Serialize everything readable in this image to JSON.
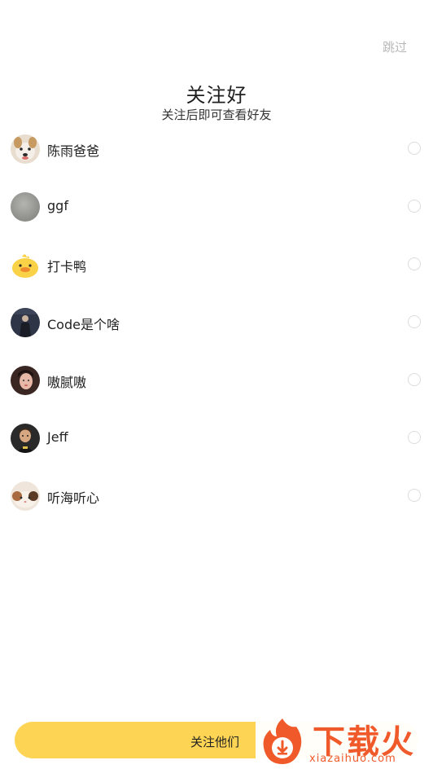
{
  "header": {
    "skip_label": "跳过",
    "title": "关注好",
    "subtitle": "关注后即可查看好友"
  },
  "friends": [
    {
      "name": "陈雨爸爸",
      "avatar": "dog-photo",
      "selected": false
    },
    {
      "name": "ggf",
      "avatar": "gray-blur-photo",
      "selected": false
    },
    {
      "name": "打卡鸭",
      "avatar": "duck-illustration",
      "selected": false
    },
    {
      "name": "Code是个啥",
      "avatar": "person-dark-photo",
      "selected": false
    },
    {
      "name": "嗷腻嗷",
      "avatar": "girl-photo",
      "selected": false
    },
    {
      "name": "Jeff",
      "avatar": "boy-photo",
      "selected": false
    },
    {
      "name": "听海听心",
      "avatar": "cat-photo",
      "selected": false
    }
  ],
  "footer": {
    "follow_button_label": "关注他们"
  },
  "watermark": {
    "title": "下载火",
    "url": "xiazaihuo.com"
  },
  "colors": {
    "accent": "#fdd454",
    "skip_text": "#b9b9b9",
    "radio_border": "#dcdcdc",
    "watermark": "#f05a2a"
  }
}
